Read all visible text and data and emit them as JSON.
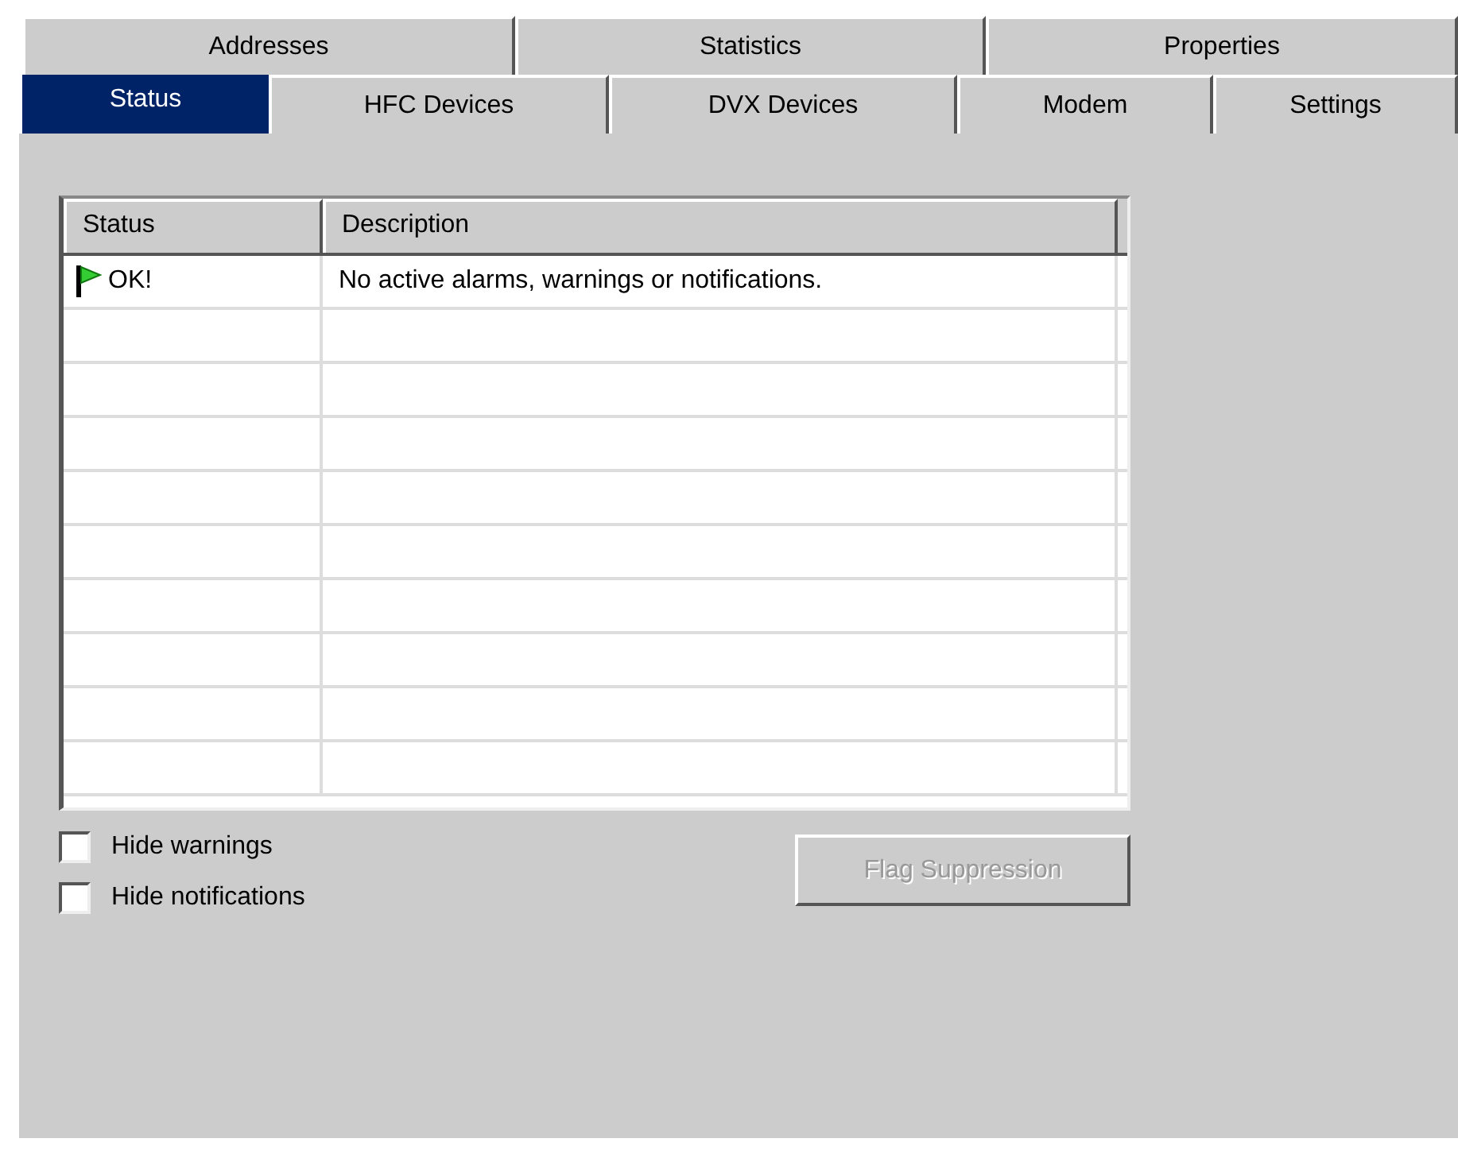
{
  "back_tabs": [
    {
      "label": "Addresses",
      "selected": false
    },
    {
      "label": "Statistics",
      "selected": false
    },
    {
      "label": "Properties",
      "selected": false
    }
  ],
  "front_tabs": [
    {
      "label": "Status",
      "selected": true
    },
    {
      "label": "HFC Devices",
      "selected": false
    },
    {
      "label": "DVX Devices",
      "selected": false
    },
    {
      "label": "Modem",
      "selected": false
    },
    {
      "label": "Settings",
      "selected": false
    }
  ],
  "table": {
    "columns": [
      "Status",
      "Description"
    ],
    "rows": [
      {
        "status": "OK!",
        "description": "No active alarms, warnings or notifications."
      }
    ]
  },
  "checkboxes": [
    {
      "label": "Hide warnings",
      "checked": false
    },
    {
      "label": "Hide notifications",
      "checked": false
    }
  ],
  "button": {
    "label": "Flag Suppression",
    "disabled": true
  }
}
